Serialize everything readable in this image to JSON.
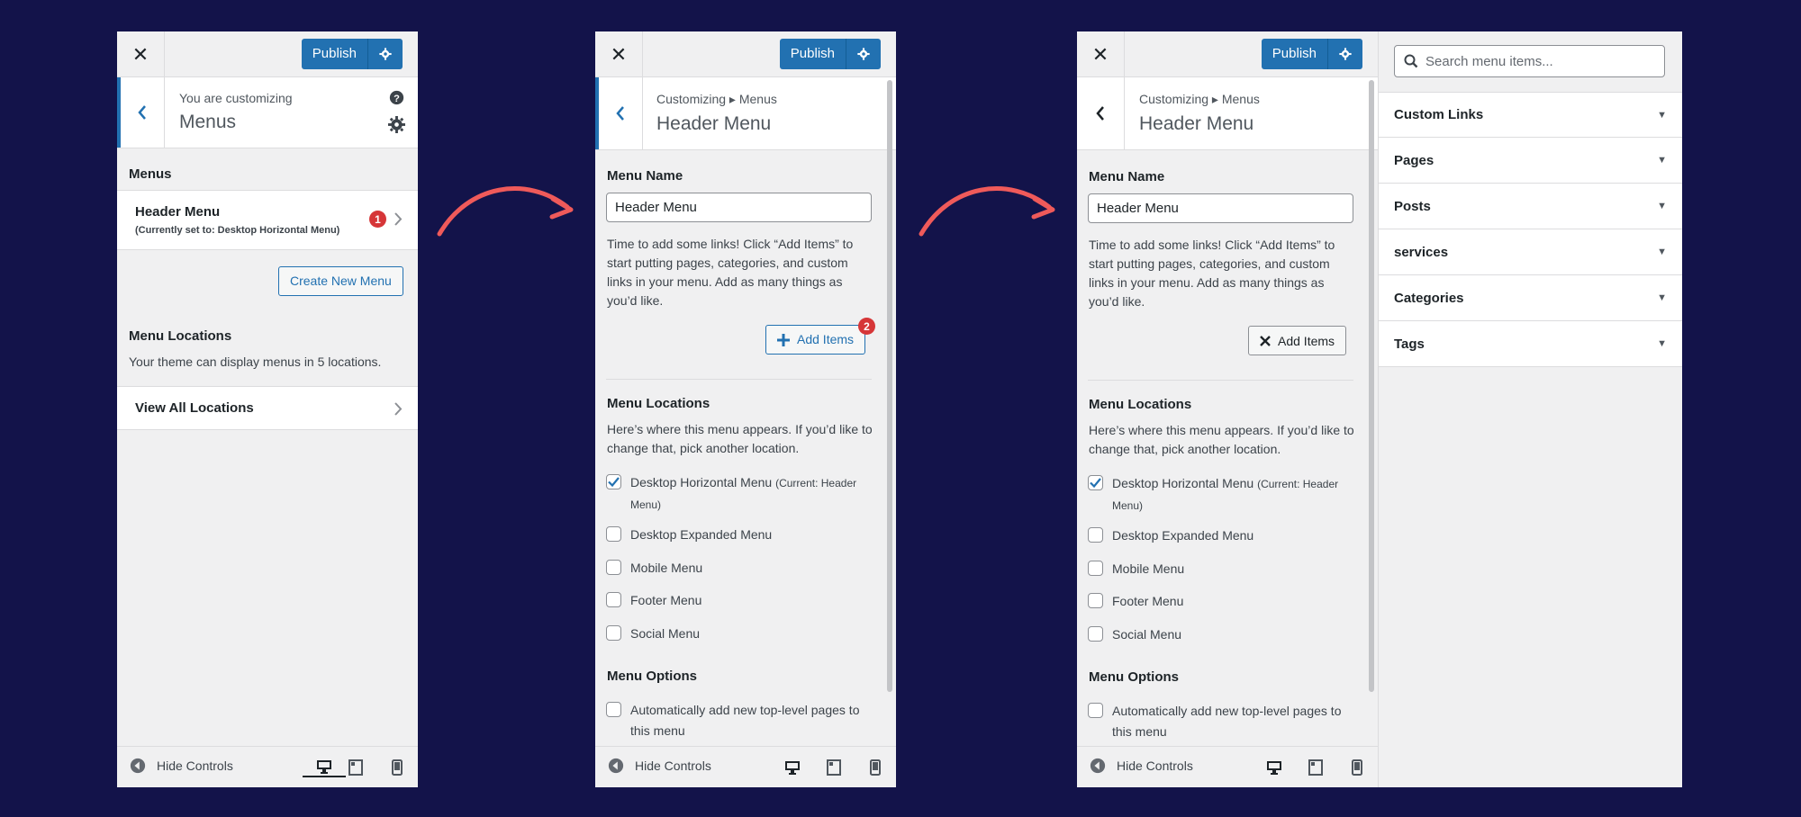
{
  "colors": {
    "background": "#13134a",
    "accent": "#2271b1",
    "badge": "#d63638",
    "arrow": "#ef5a5a"
  },
  "common": {
    "publish_label": "Publish",
    "hide_controls_label": "Hide Controls",
    "menu_name_heading": "Menu Name",
    "menu_name_value": "Header Menu",
    "intro_text": "Time to add some links! Click “Add Items” to start putting pages, categories, and custom links in your menu. Add as many things as you’d like.",
    "add_items_label": "Add Items",
    "locations_heading": "Menu Locations",
    "locations_text": "Here’s where this menu appears. If you’d like to change that, pick another location.",
    "locations": [
      {
        "label": "Desktop Horizontal Menu",
        "note": "(Current: Header Menu)",
        "checked": true
      },
      {
        "label": "Desktop Expanded Menu",
        "note": "",
        "checked": false
      },
      {
        "label": "Mobile Menu",
        "note": "",
        "checked": false
      },
      {
        "label": "Footer Menu",
        "note": "",
        "checked": false
      },
      {
        "label": "Social Menu",
        "note": "",
        "checked": false
      }
    ],
    "options_heading": "Menu Options",
    "auto_add_label": "Automatically add new top-level pages to this menu"
  },
  "panel1": {
    "customizing_label": "You are customizing",
    "title": "Menus",
    "menus_heading": "Menus",
    "menu_item_title": "Header Menu",
    "menu_item_sub": "(Currently set to: Desktop Horizontal Menu)",
    "menu_badge": "1",
    "create_button": "Create New Menu",
    "locations_heading": "Menu Locations",
    "locations_text": "Your theme can display menus in 5 locations.",
    "view_all": "View All Locations"
  },
  "panel2": {
    "breadcrumb": "Customizing ▸ Menus",
    "title": "Header Menu",
    "add_badge": "2"
  },
  "panel3": {
    "breadcrumb": "Customizing ▸ Menus",
    "title": "Header Menu"
  },
  "item_panel": {
    "search_placeholder": "Search menu items...",
    "sections": [
      "Custom Links",
      "Pages",
      "Posts",
      "services",
      "Categories",
      "Tags"
    ]
  }
}
